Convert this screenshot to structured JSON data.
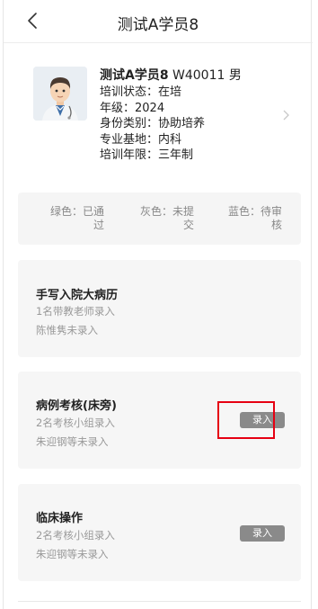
{
  "header": {
    "title": "测试A学员8"
  },
  "profile": {
    "name": "测试A学员8",
    "id_gender": " W40011 男",
    "status": "培训状态：在培",
    "grade": "年级：2024",
    "identity": "身份类别：协助培养",
    "base": "专业基地：内科",
    "duration": "培训年限：三年制"
  },
  "legend": {
    "green": [
      "绿色：已通",
      "过"
    ],
    "gray": [
      "灰色：未提",
      "交"
    ],
    "blue": [
      "蓝色：待审",
      "核"
    ]
  },
  "cards": [
    {
      "title": "手写入院大病历",
      "line1": "1名带教老师录入",
      "line2": "陈惟隽未录入",
      "button": ""
    },
    {
      "title": "病例考核(床旁)",
      "line1": "2名考核小组录入",
      "line2": "朱迎钢等未录入",
      "button": "录入"
    },
    {
      "title": "临床操作",
      "line1": "2名考核小组录入",
      "line2": "朱迎钢等未录入",
      "button": "录入"
    }
  ],
  "icons": {
    "back": "chevron-left-icon",
    "detail": "chevron-right-icon",
    "avatar": "doctor-avatar"
  },
  "colors": {
    "highlight": "#e60012",
    "button": "#8a8a8a"
  }
}
